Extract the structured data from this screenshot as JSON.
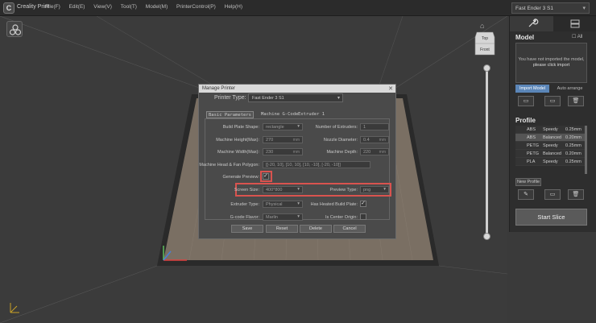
{
  "app": {
    "logo_letter": "C",
    "title": "Creality Print"
  },
  "menu": [
    "File(F)",
    "Edit(E)",
    "View(V)",
    "Tool(T)",
    "Model(M)",
    "PrinterControl(P)",
    "Help(H)"
  ],
  "printer_select": {
    "value": "Fast Ender 3 S1"
  },
  "viewport": {
    "cube_top": "Top",
    "cube_front": "Front",
    "slider_value": 0.0
  },
  "right_panel": {
    "model_title": "Model",
    "all_label": "All",
    "empty_text_1": "You have not imported the model,",
    "empty_text_2": "please click import",
    "import_label": "Import Model",
    "arrange_label": "Auto arrange",
    "profile_title": "Profile",
    "profiles": [
      {
        "material": "ABS",
        "mode": "Speedy",
        "layer": "0.25mm"
      },
      {
        "material": "ABS",
        "mode": "Balanced",
        "layer": "0.20mm"
      },
      {
        "material": "PETG",
        "mode": "Speedy",
        "layer": "0.25mm"
      },
      {
        "material": "PETG",
        "mode": "Balanced",
        "layer": "0.20mm"
      },
      {
        "material": "PLA",
        "mode": "Speedy",
        "layer": "0.25mm"
      }
    ],
    "new_profile_label": "New Profile",
    "start_slice_label": "Start Slice"
  },
  "dialog": {
    "title": "Manage Printer",
    "printer_type_label": "Printer Type:",
    "printer_type_value": "Fast Ender 3 S1",
    "tabs": [
      "Basic Parameters",
      "Machine G-Code",
      "Extruder 1"
    ],
    "fields": {
      "build_plate_shape_label": "Build Plate Shape:",
      "build_plate_shape_value": "rectangle",
      "num_extruders_label": "Number of Extruders:",
      "num_extruders_value": "1",
      "machine_height_label": "Machine Height(Max):",
      "machine_height_value": "270",
      "nozzle_diameter_label": "Nozzle Diameter:",
      "nozzle_diameter_value": "0.4",
      "machine_width_label": "Machine Width(Max):",
      "machine_width_value": "230",
      "machine_depth_label": "Machine Depth:",
      "machine_depth_value": "220",
      "head_fan_label": "Machine Head & Fan Polygon:",
      "head_fan_value": "[[-20, 10], [10, 10], [10, -10], [-20, -10]]",
      "gen_preview_label": "Generate Preview:",
      "screen_size_label": "Screen Size:",
      "screen_size_value": "400*800",
      "preview_type_label": "Preview Type:",
      "preview_type_value": "png",
      "extruder_type_label": "Extruder Type:",
      "extruder_type_value": "Physical",
      "heated_bed_label": "Has Heated Build Plate:",
      "gcode_flavor_label": "G-code Flavor:",
      "gcode_flavor_value": "Marlin",
      "origin_center_label": "Is Center Origin:"
    },
    "units": {
      "mm": "mm"
    },
    "buttons": [
      "Save",
      "Reset",
      "Delete",
      "Cancel"
    ]
  },
  "colors": {
    "accent": "#5b86b8",
    "highlight": "#d9534f",
    "bed": "#7a6f63"
  }
}
